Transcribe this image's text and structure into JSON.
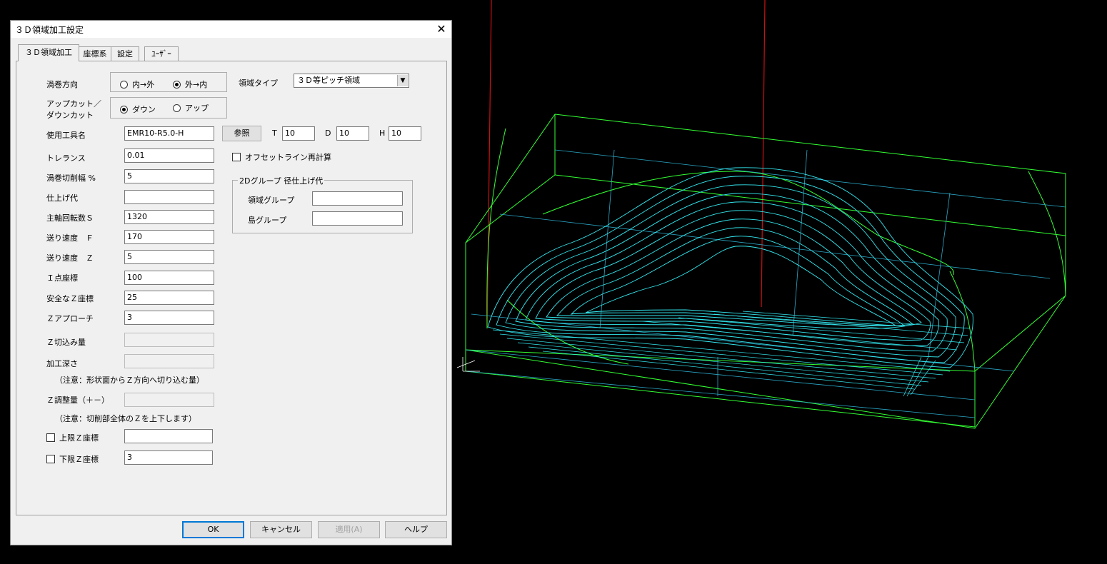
{
  "dialog": {
    "title": "３Ｄ領域加工設定",
    "close_glyph": "✕",
    "tabs": [
      {
        "label": "３Ｄ領域加工",
        "active": true
      },
      {
        "label": "座標系",
        "active": false
      },
      {
        "label": "設定",
        "active": false
      },
      {
        "label": "ﾕｰｻﾞｰ",
        "active": false
      }
    ]
  },
  "spiral": {
    "label": "渦巻方向",
    "option_in_out": "内→外",
    "option_out_in": "外→内",
    "selected": "外→内"
  },
  "cut": {
    "label_line1": "アップカット／",
    "label_line2": "ダウンカット",
    "option_down": "ダウン",
    "option_up": "アップ",
    "selected": "ダウン"
  },
  "region_type": {
    "label": "領域タイプ",
    "value": "３Ｄ等ピッチ領域"
  },
  "tool": {
    "label": "使用工具名",
    "value": "EMR10-R5.0-H",
    "browse_label": "参照",
    "t_label": "T",
    "t_value": "10",
    "d_label": "D",
    "d_value": "10",
    "h_label": "H",
    "h_value": "10"
  },
  "fields": [
    {
      "label": "トレランス",
      "value": "0.01"
    },
    {
      "label": "渦巻切削幅 %",
      "value": "5"
    },
    {
      "label": "仕上げ代",
      "value": ""
    },
    {
      "label": "主軸回転数Ｓ",
      "value": "1320"
    },
    {
      "label": "送り速度　Ｆ",
      "value": "170"
    },
    {
      "label": "送り速度　Ｚ",
      "value": "5"
    },
    {
      "label": "Ｉ点座標",
      "value": "100"
    },
    {
      "label": "安全なＺ座標",
      "value": "25"
    },
    {
      "label": "Ｚアプローチ",
      "value": "3"
    },
    {
      "label": "Ｚ切込み量",
      "value": ""
    },
    {
      "label": "加工深さ",
      "value": ""
    }
  ],
  "note1": "（注意：形状面からＺ方向へ切り込む量）",
  "z_adjust": {
    "label": "Ｚ調整量（＋－）",
    "value": ""
  },
  "note2": "（注意：切削部全体のＺを上下します）",
  "upper_z": {
    "label": "上限Ｚ座標",
    "checked": false,
    "value": ""
  },
  "lower_z": {
    "label": "下限Ｚ座標",
    "checked": false,
    "value": "3"
  },
  "offset_recalc": {
    "label": "オフセットライン再計算",
    "checked": false
  },
  "group2d": {
    "title": "2Dグループ 径仕上げ代",
    "region_label": "領域グループ",
    "region_value": "",
    "island_label": "島グループ",
    "island_value": ""
  },
  "buttons": {
    "ok": "OK",
    "cancel": "キャンセル",
    "apply": "適用(A)",
    "help": "ヘルプ"
  },
  "colors": {
    "background": "#000000",
    "wireframe_green": "#33ff33",
    "toolpath_cyan": "#33e8f0",
    "axis_red": "#cc1111"
  }
}
